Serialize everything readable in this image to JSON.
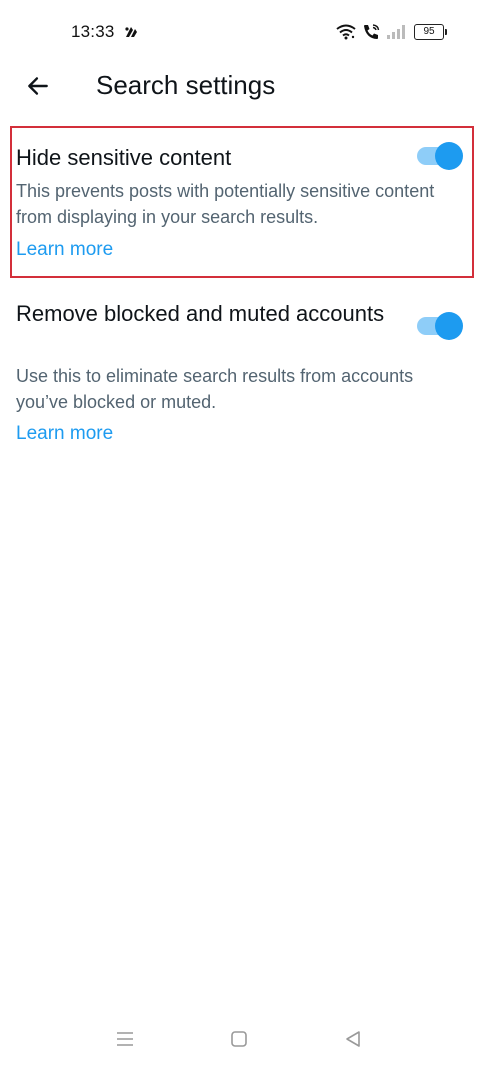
{
  "status_bar": {
    "time": "13:33",
    "battery_level": "95",
    "icons": [
      "app-notification-icon",
      "wifi-icon",
      "wifi-call-icon",
      "signal-icon",
      "battery-icon"
    ]
  },
  "header": {
    "title": "Search settings",
    "back_icon": "arrow-left-icon"
  },
  "settings": [
    {
      "title": "Hide sensitive content",
      "description": "This prevents posts with potentially sensitive content from displaying in your search results.",
      "learn_more": "Learn more",
      "enabled": true
    },
    {
      "title": "Remove blocked and muted accounts",
      "description": "Use this to eliminate search results from accounts you’ve blocked or muted.",
      "learn_more": "Learn more",
      "enabled": true
    }
  ],
  "navigation_bar": {
    "icons": [
      "menu-icon",
      "home-square-icon",
      "back-triangle-icon"
    ]
  },
  "colors": {
    "accent": "#1d9bf0",
    "toggle_track": "#8ecdf8",
    "title_text": "#0f1419",
    "secondary_text": "#536471",
    "highlight": "#d32f3a"
  }
}
